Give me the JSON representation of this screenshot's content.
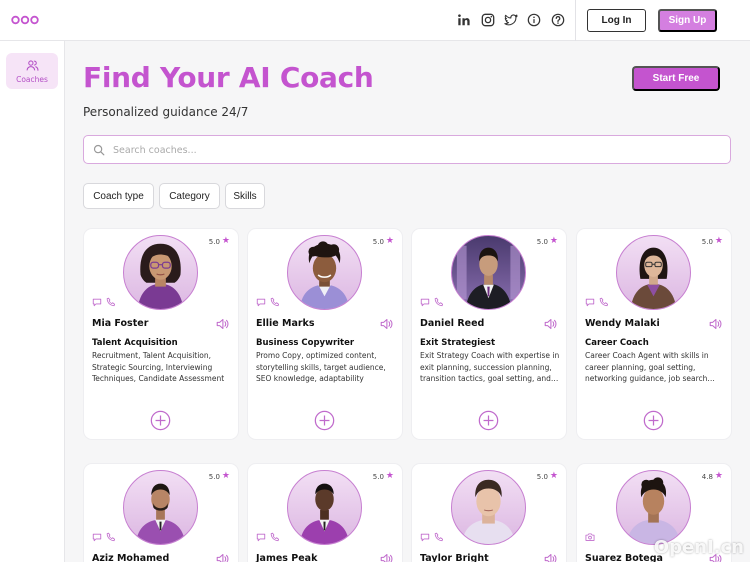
{
  "header": {
    "login_label": "Log In",
    "signup_label": "Sign Up",
    "icons": [
      "linkedin-icon",
      "instagram-icon",
      "twitter-icon",
      "info-icon",
      "help-icon"
    ]
  },
  "sidebar": {
    "items": [
      {
        "label": "Coaches",
        "icon": "users-icon"
      }
    ]
  },
  "main": {
    "title": "Find Your AI Coach",
    "subtitle": "Personalized guidance 24/7",
    "start_label": "Start Free",
    "search_placeholder": "Search coaches...",
    "filters": [
      "Coach type",
      "Category",
      "Skills"
    ]
  },
  "coaches": [
    {
      "name": "Mia Foster",
      "rating": "5.0",
      "role": "Talent Acquisition",
      "description": "Recruitment, Talent Acquisition, Strategic Sourcing, Interviewing Techniques, Candidate Assessment"
    },
    {
      "name": "Ellie Marks",
      "rating": "5.0",
      "role": "Business Copywriter",
      "description": "Promo Copy, optimized content, storytelling skills, target audience, SEO knowledge, adaptability"
    },
    {
      "name": "Daniel Reed",
      "rating": "5.0",
      "role": "Exit Strategiest",
      "description": "Exit Strategy Coach with expertise in exit planning, succession planning, transition tactics, goal setting, and more"
    },
    {
      "name": "Wendy Malaki",
      "rating": "5.0",
      "role": "Career Coach",
      "description": "Career Coach Agent with skills in career planning, goal setting, networking guidance, job search strategies"
    },
    {
      "name": "Aziz Mohamed",
      "rating": "5.0"
    },
    {
      "name": "James Peak",
      "rating": "5.0"
    },
    {
      "name": "Taylor Bright",
      "rating": "5.0"
    },
    {
      "name": "Suarez Botega",
      "rating": "4.8"
    }
  ],
  "colors": {
    "accent": "#c454cf",
    "signup": "#d47fe0",
    "sidebar_active": "#f6e4f7"
  },
  "watermark": "OpenI.cn"
}
